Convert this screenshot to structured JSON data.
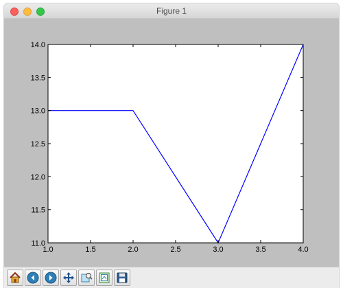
{
  "window": {
    "title": "Figure 1"
  },
  "toolbar": {
    "buttons": [
      {
        "name": "home",
        "icon": "home-icon"
      },
      {
        "name": "back",
        "icon": "back-arrow-icon"
      },
      {
        "name": "forward",
        "icon": "forward-arrow-icon"
      },
      {
        "name": "pan",
        "icon": "pan-arrows-icon"
      },
      {
        "name": "zoom",
        "icon": "zoom-rectangle-icon"
      },
      {
        "name": "configure-subplots",
        "icon": "subplots-icon"
      },
      {
        "name": "save",
        "icon": "floppy-disk-icon"
      }
    ]
  },
  "chart_data": {
    "type": "line",
    "x": [
      1.0,
      2.0,
      3.0,
      4.0
    ],
    "series": [
      {
        "values": [
          13.0,
          13.0,
          11.0,
          14.0
        ],
        "color": "#0000ff"
      }
    ],
    "xlim": [
      1.0,
      4.0
    ],
    "ylim": [
      11.0,
      14.0
    ],
    "xticks": [
      "1.0",
      "1.5",
      "2.0",
      "2.5",
      "3.0",
      "3.5",
      "4.0"
    ],
    "yticks": [
      "11.0",
      "11.5",
      "12.0",
      "12.5",
      "13.0",
      "13.5",
      "14.0"
    ],
    "grid": false,
    "background": "#bfbfbf",
    "axes_background": "#ffffff"
  }
}
